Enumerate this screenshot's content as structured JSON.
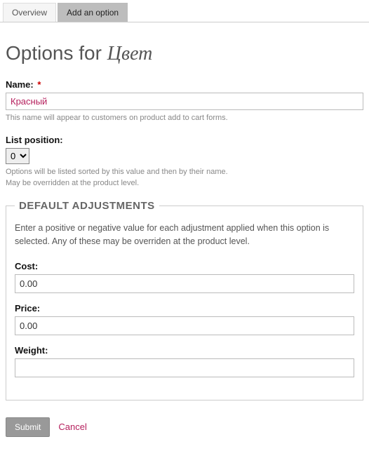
{
  "tabs": {
    "overview": "Overview",
    "add_option": "Add an option"
  },
  "title_prefix": "Options for ",
  "title_name": "Цвет",
  "name": {
    "label": "Name:",
    "required": "*",
    "value": "Красный",
    "help": "This name will appear to customers on product add to cart forms."
  },
  "list_position": {
    "label": "List position:",
    "value": "0",
    "help1": "Options will be listed sorted by this value and then by their name.",
    "help2": "May be overridden at the product level."
  },
  "adjustments": {
    "legend": "DEFAULT ADJUSTMENTS",
    "desc": "Enter a positive or negative value for each adjustment applied when this option is selected. Any of these may be overriden at the product level.",
    "cost": {
      "label": "Cost:",
      "value": "0.00"
    },
    "price": {
      "label": "Price:",
      "value": "0.00"
    },
    "weight": {
      "label": "Weight:",
      "value": ""
    }
  },
  "actions": {
    "submit": "Submit",
    "cancel": "Cancel"
  }
}
